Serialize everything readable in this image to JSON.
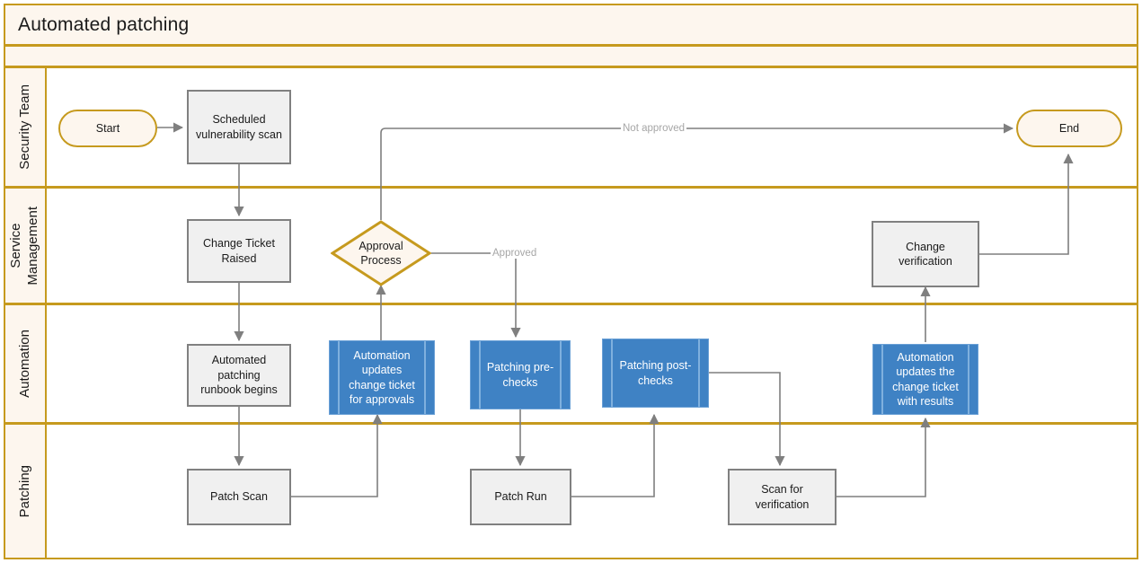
{
  "diagram": {
    "title": "Automated patching",
    "type": "swimlane-flowchart",
    "colors": {
      "pool_border": "#C69A1E",
      "lane_header_fill": "#FDF6EE",
      "process_fill": "#F0F0F0",
      "process_border": "#808080",
      "automation_fill": "#3F82C4",
      "connector": "#7F7F7F",
      "edge_label_text": "#A6A6A6"
    }
  },
  "lanes": [
    {
      "id": "security",
      "label": "Security Team"
    },
    {
      "id": "service",
      "label": "Service\nManagement"
    },
    {
      "id": "automation",
      "label": "Automation"
    },
    {
      "id": "patching",
      "label": "Patching"
    }
  ],
  "nodes": {
    "start": {
      "label": "Start",
      "shape": "terminator",
      "lane": "security"
    },
    "scheduled_scan": {
      "label": "Scheduled\nvulnerability scan",
      "shape": "process",
      "lane": "security"
    },
    "end": {
      "label": "End",
      "shape": "terminator",
      "lane": "security"
    },
    "change_ticket_raised": {
      "label": "Change Ticket\nRaised",
      "shape": "process",
      "lane": "service"
    },
    "approval_process": {
      "label": "Approval\nProcess",
      "shape": "decision",
      "lane": "service"
    },
    "change_verification": {
      "label": "Change verification",
      "shape": "process",
      "lane": "service"
    },
    "runbook_begins": {
      "label": "Automated patching\nrunbook begins",
      "shape": "process",
      "lane": "automation"
    },
    "updates_ticket_approvals": {
      "label": "Automation\nupdates\nchange ticket\nfor approvals",
      "shape": "predefined-process",
      "lane": "automation"
    },
    "patching_pre_checks": {
      "label": "Patching pre-\nchecks",
      "shape": "predefined-process",
      "lane": "automation"
    },
    "patching_post_checks": {
      "label": "Patching post-\nchecks",
      "shape": "predefined-process",
      "lane": "automation"
    },
    "updates_ticket_results": {
      "label": "Automation\nupdates the\nchange ticket\nwith results",
      "shape": "predefined-process",
      "lane": "automation"
    },
    "patch_scan": {
      "label": "Patch Scan",
      "shape": "process",
      "lane": "patching"
    },
    "patch_run": {
      "label": "Patch Run",
      "shape": "process",
      "lane": "patching"
    },
    "scan_for_verification": {
      "label": "Scan for verification",
      "shape": "process",
      "lane": "patching"
    }
  },
  "edge_labels": {
    "not_approved": "Not approved",
    "approved": "Approved"
  },
  "edges": [
    {
      "from": "start",
      "to": "scheduled_scan",
      "label": ""
    },
    {
      "from": "scheduled_scan",
      "to": "change_ticket_raised",
      "label": ""
    },
    {
      "from": "change_ticket_raised",
      "to": "runbook_begins",
      "label": ""
    },
    {
      "from": "runbook_begins",
      "to": "patch_scan",
      "label": ""
    },
    {
      "from": "patch_scan",
      "to": "updates_ticket_approvals",
      "label": ""
    },
    {
      "from": "updates_ticket_approvals",
      "to": "approval_process",
      "label": ""
    },
    {
      "from": "approval_process",
      "to": "end",
      "label": "Not approved"
    },
    {
      "from": "approval_process",
      "to": "patching_pre_checks",
      "label": "Approved"
    },
    {
      "from": "patching_pre_checks",
      "to": "patch_run",
      "label": ""
    },
    {
      "from": "patch_run",
      "to": "patching_post_checks",
      "label": ""
    },
    {
      "from": "patching_post_checks",
      "to": "scan_for_verification",
      "label": ""
    },
    {
      "from": "scan_for_verification",
      "to": "updates_ticket_results",
      "label": ""
    },
    {
      "from": "updates_ticket_results",
      "to": "change_verification",
      "label": ""
    },
    {
      "from": "change_verification",
      "to": "end",
      "label": ""
    }
  ]
}
